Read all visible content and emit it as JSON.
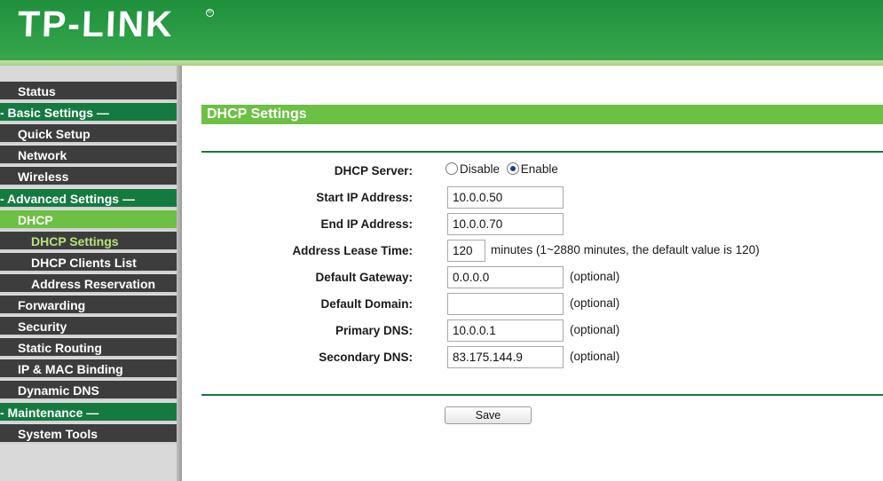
{
  "header": {
    "brand": "TP-LINK",
    "registered_mark": "®"
  },
  "sidebar": {
    "items": [
      {
        "label": "Status",
        "kind": "dark",
        "indent": 20
      },
      {
        "label": "- Basic Settings —",
        "kind": "section",
        "indent": 0
      },
      {
        "label": "Quick Setup",
        "kind": "dark",
        "indent": 20
      },
      {
        "label": "Network",
        "kind": "dark",
        "indent": 20
      },
      {
        "label": "Wireless",
        "kind": "dark",
        "indent": 20
      },
      {
        "label": "- Advanced Settings —",
        "kind": "section",
        "indent": 0
      },
      {
        "label": "DHCP",
        "kind": "active",
        "indent": 20
      },
      {
        "label": "DHCP Settings",
        "kind": "sub-active",
        "indent": 35
      },
      {
        "label": "DHCP Clients List",
        "kind": "sub",
        "indent": 35
      },
      {
        "label": "Address Reservation",
        "kind": "sub",
        "indent": 35
      },
      {
        "label": "Forwarding",
        "kind": "dark",
        "indent": 20
      },
      {
        "label": "Security",
        "kind": "dark",
        "indent": 20
      },
      {
        "label": "Static Routing",
        "kind": "dark",
        "indent": 20
      },
      {
        "label": "IP & MAC Binding",
        "kind": "dark",
        "indent": 20
      },
      {
        "label": "Dynamic DNS",
        "kind": "dark",
        "indent": 20
      },
      {
        "label": "- Maintenance —",
        "kind": "section",
        "indent": 0
      },
      {
        "label": "System Tools",
        "kind": "dark",
        "indent": 20
      }
    ]
  },
  "main": {
    "title": "DHCP Settings",
    "dhcp_server": {
      "label": "DHCP Server:",
      "options": [
        "Disable",
        "Enable"
      ],
      "selected": "Enable"
    },
    "start_ip": {
      "label": "Start IP Address:",
      "value": "10.0.0.50"
    },
    "end_ip": {
      "label": "End IP Address:",
      "value": "10.0.0.70"
    },
    "lease_time": {
      "label": "Address Lease Time:",
      "value": "120",
      "note": "minutes (1~2880 minutes, the default value is 120)"
    },
    "gateway": {
      "label": "Default Gateway:",
      "value": "0.0.0.0",
      "note": "(optional)"
    },
    "domain": {
      "label": "Default Domain:",
      "value": "",
      "note": "(optional)"
    },
    "primary_dns": {
      "label": "Primary DNS:",
      "value": "10.0.0.1",
      "note": "(optional)"
    },
    "secondary_dns": {
      "label": "Secondary DNS:",
      "value": "83.175.144.9",
      "note": "(optional)"
    },
    "save_label": "Save"
  },
  "colors": {
    "header_green": "#2c9e45",
    "section_green": "#147a40",
    "active_green": "#6cc043",
    "nav_dark": "#3d3d3d",
    "sub_active_text": "#b6e37a"
  }
}
